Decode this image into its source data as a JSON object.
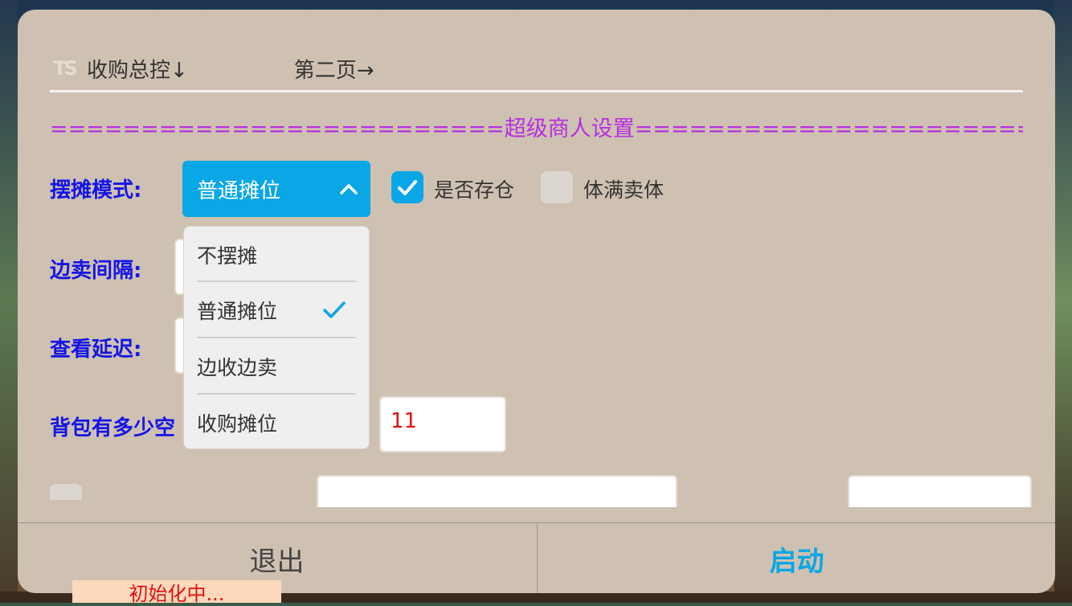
{
  "tabs": {
    "main": "收购总控↓",
    "second": "第二页→"
  },
  "logo_text": "TS",
  "section_title": "=========================超级商人设置=========================",
  "stall_mode": {
    "label": "摆摊模式:",
    "selected": "普通摊位",
    "options": [
      "不摆摊",
      "普通摊位",
      "边收边卖",
      "收购摊位"
    ],
    "selected_index": 1
  },
  "checkboxes": [
    {
      "label": "是否存仓",
      "checked": true
    },
    {
      "label": "体满卖体",
      "checked": false
    }
  ],
  "rows": {
    "sell_interval_label": "边卖间隔:",
    "view_delay_label": "查看延迟:",
    "bag_space_label": "背包有多少空",
    "bag_space_value": "11"
  },
  "footer": {
    "exit": "退出",
    "start": "启动"
  },
  "toast": "初始化中...",
  "colors": {
    "accent": "#0aa7e6",
    "label_blue": "#1515e6",
    "section_purple": "#b72fe0",
    "value_red": "#e01010",
    "panel": "#cfc1b2"
  }
}
